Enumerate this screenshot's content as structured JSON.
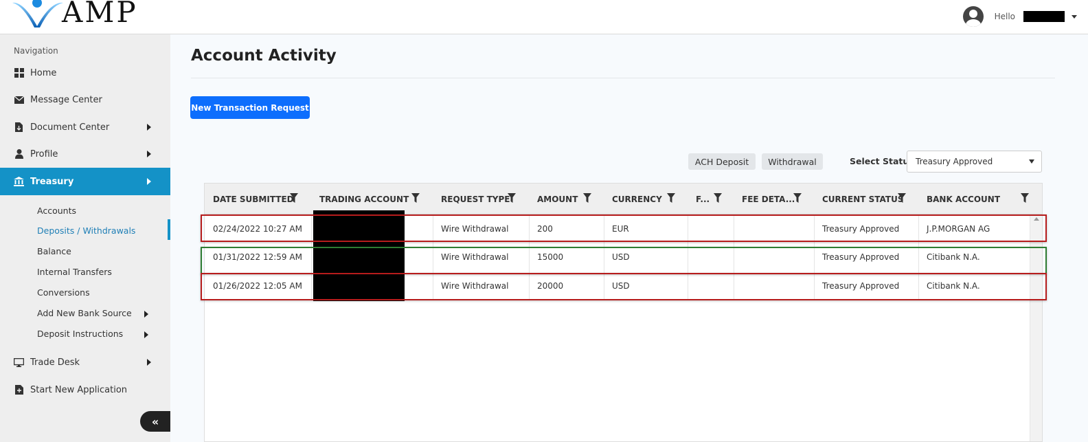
{
  "header": {
    "logo_text": "AMP",
    "greeting": "Hello"
  },
  "sidebar": {
    "heading": "Navigation",
    "items": [
      {
        "label": "Home",
        "icon": "grid-icon"
      },
      {
        "label": "Message Center",
        "icon": "envelope-icon"
      },
      {
        "label": "Document Center",
        "icon": "document-icon"
      },
      {
        "label": "Profile",
        "icon": "user-icon"
      },
      {
        "label": "Treasury",
        "icon": "bank-icon"
      },
      {
        "label": "Trade Desk",
        "icon": "monitor-icon"
      },
      {
        "label": "Start New Application",
        "icon": "new-document-icon"
      }
    ],
    "treasury_sub": [
      {
        "label": "Accounts"
      },
      {
        "label": "Deposits / Withdrawals"
      },
      {
        "label": "Balance"
      },
      {
        "label": "Internal Transfers"
      },
      {
        "label": "Conversions"
      },
      {
        "label": "Add New Bank Source"
      },
      {
        "label": "Deposit Instructions"
      }
    ],
    "collapse_label": "«"
  },
  "main": {
    "title": "Account Activity",
    "new_request_label": "New Transaction Request",
    "filters": {
      "ach_label": "ACH Deposit",
      "withdrawal_label": "Withdrawal",
      "status_label": "Select Status",
      "status_value": "Treasury Approved"
    }
  },
  "table": {
    "columns": [
      "DATE SUBMITTED",
      "TRADING ACCOUNT",
      "REQUEST TYPE",
      "AMOUNT",
      "CURRENCY",
      "F...",
      "FEE DETA...",
      "CURRENT STATUS",
      "BANK ACCOUNT"
    ],
    "rows": [
      {
        "date": "02/24/2022 10:27 AM",
        "account": "",
        "type": "Wire Withdrawal",
        "amount": "200",
        "currency": "EUR",
        "fee": "",
        "fee_details": "",
        "status": "Treasury Approved",
        "bank": "J.P.MORGAN AG",
        "highlight": "#b71c1c"
      },
      {
        "date": "01/31/2022 12:59 AM",
        "account": "",
        "type": "Wire Withdrawal",
        "amount": "15000",
        "currency": "USD",
        "fee": "",
        "fee_details": "",
        "status": "Treasury Approved",
        "bank": "Citibank N.A.",
        "highlight": "#2e7d32"
      },
      {
        "date": "01/26/2022 12:05 AM",
        "account": "",
        "type": "Wire Withdrawal",
        "amount": "20000",
        "currency": "USD",
        "fee": "",
        "fee_details": "",
        "status": "Treasury Approved",
        "bank": "Citibank N.A.",
        "highlight": "#b71c1c"
      }
    ]
  },
  "colors": {
    "primary": "#0d6efd",
    "active_nav": "#1492c7",
    "highlight_red": "#b71c1c",
    "highlight_green": "#2e7d32"
  }
}
